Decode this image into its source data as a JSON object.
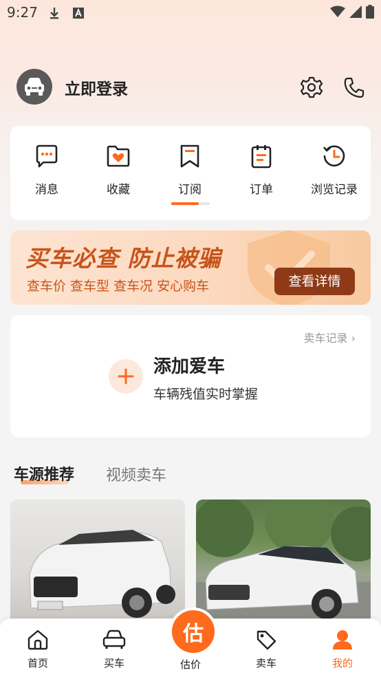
{
  "status_bar": {
    "time": "9:27"
  },
  "header": {
    "login_label": "立即登录"
  },
  "menu": {
    "items": [
      {
        "label": "消息",
        "icon": "message-icon"
      },
      {
        "label": "收藏",
        "icon": "favorite-icon"
      },
      {
        "label": "订阅",
        "icon": "bookmark-icon"
      },
      {
        "label": "订单",
        "icon": "order-icon"
      },
      {
        "label": "浏览记录",
        "icon": "history-icon"
      }
    ],
    "active_index": 2
  },
  "banner": {
    "title": "买车必查  防止被骗",
    "subtitle": "查车价 查车型 查车况 安心购车",
    "button_label": "查看详情"
  },
  "car_card": {
    "sell_record_label": "卖车记录",
    "title": "添加爱车",
    "subtitle": "车辆残值实时掌握"
  },
  "section_tabs": {
    "active": "车源推荐",
    "inactive": "视频卖车"
  },
  "bottom_nav": {
    "items": [
      {
        "label": "首页"
      },
      {
        "label": "买车"
      },
      {
        "label": "估价",
        "center_glyph": "估"
      },
      {
        "label": "卖车"
      },
      {
        "label": "我的"
      }
    ],
    "active_index": 4
  },
  "colors": {
    "accent": "#ff6a1c",
    "banner_button": "#8e3a17"
  }
}
